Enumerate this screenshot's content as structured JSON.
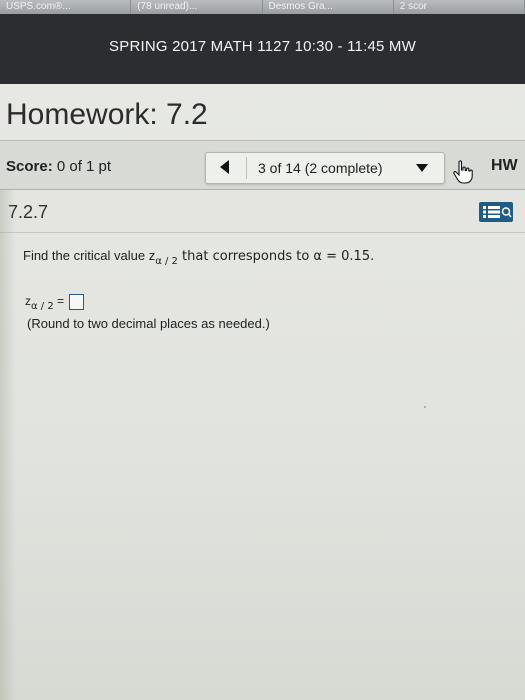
{
  "browser_tabs": [
    {
      "label": "USPS.com®..."
    },
    {
      "label": "(78 unread)..."
    },
    {
      "label": "Desmos Gra..."
    },
    {
      "label": "2 scor"
    }
  ],
  "course_header": {
    "title": "SPRING 2017 MATH 1127 10:30 - 11:45 MW"
  },
  "homework": {
    "title": "Homework: 7.2"
  },
  "scorebar": {
    "score_label": "Score:",
    "score_value": "0 of 1 pt",
    "nav_text": "3 of 14 (2 complete)",
    "hw_link": "HW"
  },
  "question": {
    "number": "7.2.7",
    "text_before": "Find the critical value z",
    "subscript": "α / 2",
    "text_after": " that corresponds to α = 0.15.",
    "answer_prefix": "z",
    "answer_subscript": "α / 2",
    "answer_equals": " =",
    "hint": "(Round to two decimal places as needed.)"
  },
  "icons": {
    "prev": "triangle-left-icon",
    "dropdown": "triangle-down-icon",
    "cursor": "hand-cursor-icon",
    "question_list": "list-icon",
    "search_partial": "Q"
  },
  "colors": {
    "header_bg": "#2b2d30",
    "accent_blue": "#1f5d86",
    "page_bg": "#e4e5e1"
  }
}
